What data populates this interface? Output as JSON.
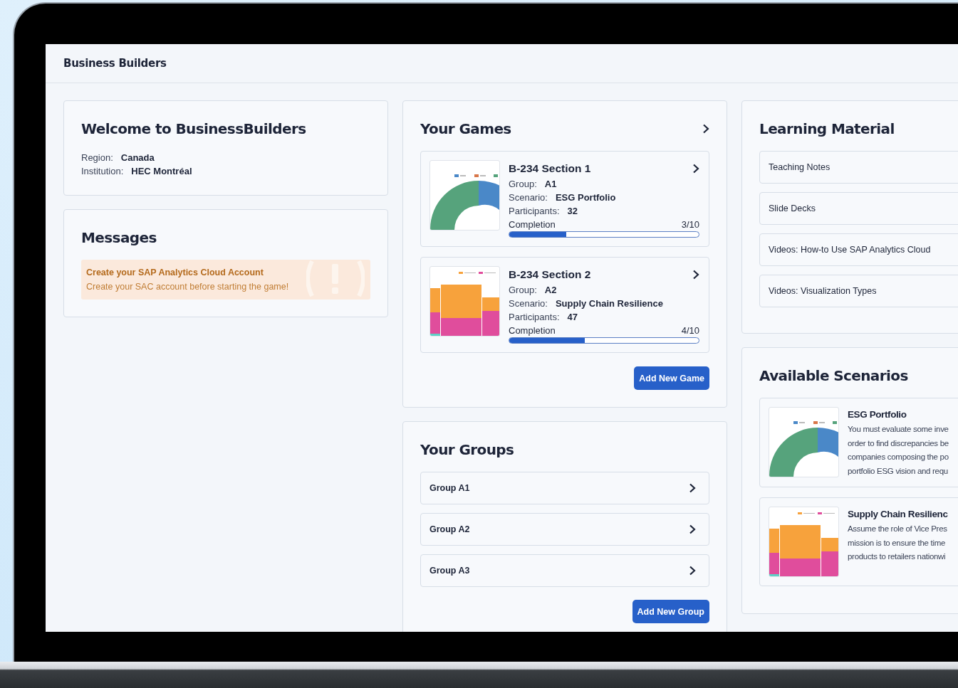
{
  "app": {
    "title": "Business Builders"
  },
  "welcome": {
    "title": "Welcome to BusinessBuilders",
    "fields": [
      {
        "label": "Region:",
        "value": "Canada"
      },
      {
        "label": "Institution:",
        "value": "HEC Montréal"
      }
    ]
  },
  "messages": {
    "title": "Messages",
    "alerts": [
      {
        "title": "Create your SAP Analytics Cloud Account",
        "text": "Create your SAC account before starting the game!"
      }
    ]
  },
  "games": {
    "title": "Your Games",
    "items": [
      {
        "name": "B-234 Section 1",
        "kind": "half-donut",
        "fields": [
          {
            "label": "Group:",
            "value": "A1"
          },
          {
            "label": "Scenario:",
            "value": "ESG Portfolio"
          },
          {
            "label": "Participants:",
            "value": "32"
          }
        ],
        "completion_label": "Completion",
        "completion": "3/10",
        "level": 0.3
      },
      {
        "name": "B-234 Section 2",
        "kind": "marimekko",
        "fields": [
          {
            "label": "Group:",
            "value": "A2"
          },
          {
            "label": "Scenario:",
            "value": "Supply Chain Resilience"
          },
          {
            "label": "Participants:",
            "value": "47"
          }
        ],
        "completion_label": "Completion",
        "completion": "4/10",
        "level": 0.4
      }
    ],
    "button": "Add New Game"
  },
  "groups": {
    "title": "Your Groups",
    "items": [
      "Group A1",
      "Group A2",
      "Group A3"
    ],
    "button": "Add New Group"
  },
  "learning": {
    "title": "Learning Material",
    "items": [
      "Teaching Notes",
      "Slide Decks",
      "Videos: How-to Use SAP Analytics Cloud",
      "Videos: Visualization Types"
    ]
  },
  "scenarios": {
    "title": "Available Scenarios",
    "items": [
      {
        "name": "ESG Portfolio",
        "kind": "half-donut",
        "description_lines": [
          "You must evaluate some inve",
          "order to find discrepancies be",
          "companies composing the po",
          "portfolio ESG vision and requ"
        ]
      },
      {
        "name": "Supply Chain Resilienc",
        "kind": "marimekko",
        "description_lines": [
          "Assume the role of Vice Pres",
          "mission is to ensure the time",
          "products to retailers nationwi"
        ]
      }
    ]
  }
}
